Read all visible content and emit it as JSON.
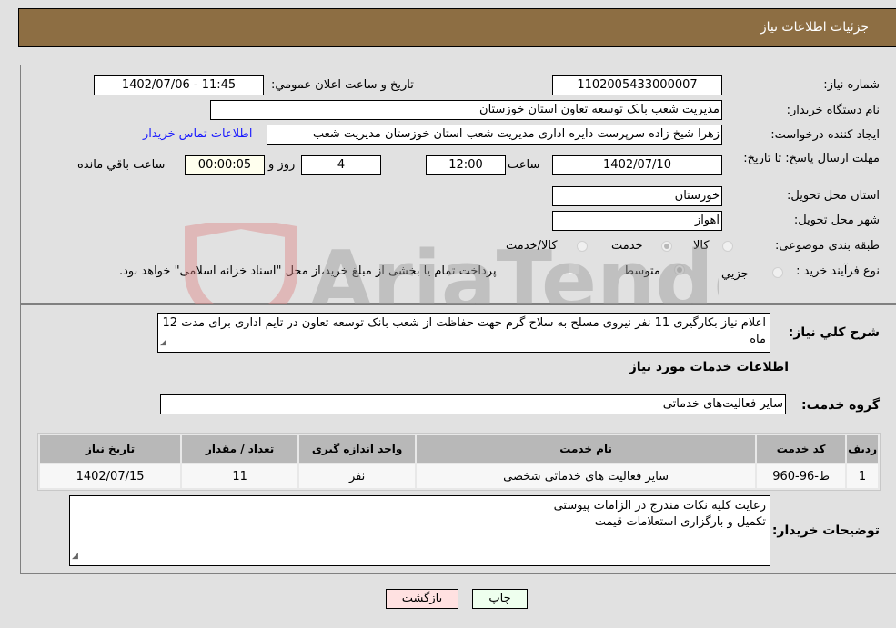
{
  "header": {
    "title": "جزئیات اطلاعات نیاز"
  },
  "details": {
    "need_number_label": "شماره نیاز:",
    "need_number": "1102005433000007",
    "announce_label": "تاریخ و ساعت اعلان عمومي:",
    "announce_value": "1402/07/06 - 11:45",
    "buyer_org_label": "نام دستگاه خریدار:",
    "buyer_org": "مدیریت شعب بانک توسعه تعاون استان خوزستان",
    "requester_label": "ایجاد کننده درخواست:",
    "requester": "زهرا شیخ زاده سرپرست دایره اداری مدیریت شعب استان خوزستان مدیریت شعب",
    "buyer_contact_link": "اطلاعات تماس خریدار",
    "deadline_label": "مهلت ارسال پاسخ: تا تاریخ:",
    "deadline_date": "1402/07/10",
    "time_label": "ساعت",
    "deadline_time": "12:00",
    "days_value": "4",
    "days_label": "روز و",
    "remaining_time": "00:00:05",
    "remaining_label": "ساعت باقي مانده",
    "province_label": "استان محل تحویل:",
    "province": "خوزستان",
    "city_label": "شهر محل تحویل:",
    "city": "اهواز",
    "category_label": "طبقه بندی موضوعی:",
    "category_options": [
      {
        "label": "کالا",
        "checked": false
      },
      {
        "label": "خدمت",
        "checked": true
      },
      {
        "label": "کالا/خدمت",
        "checked": false
      }
    ],
    "process_label": "نوع فرآیند خرید :",
    "process_options": [
      {
        "label": "جزيي",
        "checked": false
      },
      {
        "label": "متوسط",
        "checked": true
      }
    ],
    "treasury_checkbox_label": "پرداخت تمام یا بخشی از مبلغ خرید،از محل \"اسناد خزانه اسلامی\" خواهد بود.",
    "treasury_checked": false
  },
  "description": {
    "label": "شرح کلي نیاز:",
    "text": "اعلام نیاز بکارگیری 11 نفر نیروی مسلح به سلاح گرم جهت حفاظت از شعب بانک توسعه تعاون در تایم اداری برای مدت 12 ماه"
  },
  "services": {
    "section_title": "اطلاعات خدمات مورد نیاز",
    "group_label": "گروه خدمت:",
    "group_value": "سایر فعالیت‌های خدماتی",
    "columns": [
      "ردیف",
      "کد خدمت",
      "نام خدمت",
      "واحد اندازه گیری",
      "تعداد / مقدار",
      "تاریخ نیاز"
    ],
    "rows": [
      [
        "1",
        "ط-96-960",
        "سایر فعالیت های خدماتی شخصی",
        "نفر",
        "11",
        "1402/07/15"
      ]
    ]
  },
  "buyer_notes": {
    "label": "توضیحات خریدار:",
    "lines": [
      "رعایت کلیه نکات مندرج در الزامات پیوستی",
      "تکمیل و بارگزاری استعلامات قیمت"
    ]
  },
  "buttons": {
    "print": "چاپ",
    "back": "بازگشت"
  },
  "watermark": {
    "text": "AriaTender.neT"
  }
}
